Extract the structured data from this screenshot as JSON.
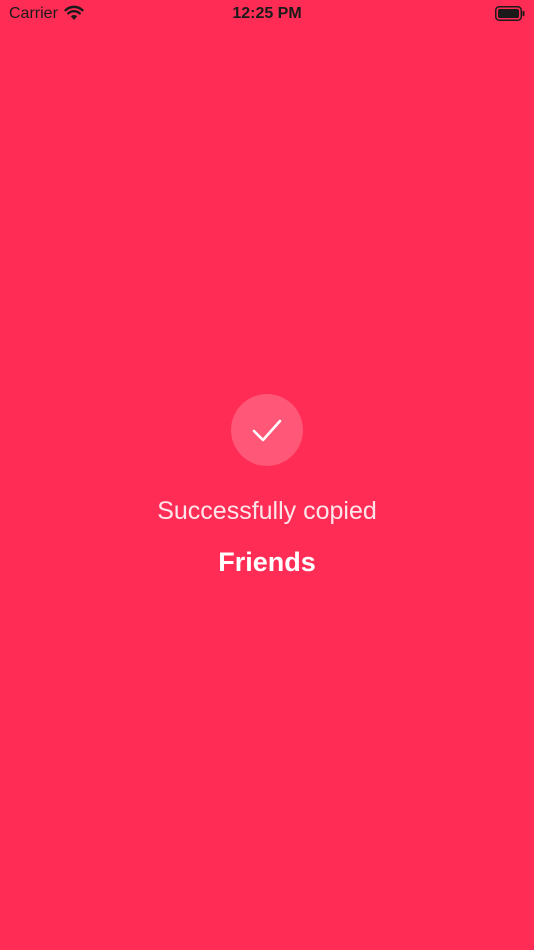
{
  "status_bar": {
    "carrier": "Carrier",
    "time": "12:25 PM",
    "icons": [
      "wifi-icon",
      "battery-icon"
    ]
  },
  "content": {
    "icon": "checkmark-icon",
    "message": "Successfully copied",
    "item_name": "Friends"
  },
  "colors": {
    "background": "#FF2D55",
    "text": "#FFFFFF",
    "status_text": "#1A1A1A"
  }
}
